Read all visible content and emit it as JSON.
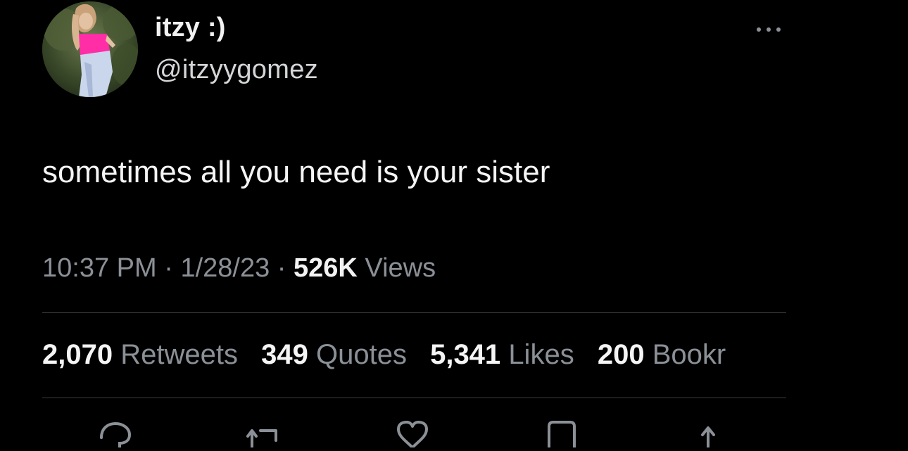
{
  "tweet": {
    "display_name": "itzy :)",
    "handle": "@itzyygomez",
    "text": "sometimes all you need is your sister",
    "time": "10:37 PM",
    "separator": "·",
    "date": "1/28/23",
    "views_count": "526K",
    "views_label": "Views"
  },
  "stats": [
    {
      "count": "2,070",
      "label": "Retweets"
    },
    {
      "count": "349",
      "label": "Quotes"
    },
    {
      "count": "5,341",
      "label": "Likes"
    },
    {
      "count": "200",
      "label": "Bookr"
    }
  ],
  "actions": [
    {
      "icon": "reply-icon"
    },
    {
      "icon": "retweet-icon"
    },
    {
      "icon": "like-icon"
    },
    {
      "icon": "bookmark-icon"
    },
    {
      "icon": "share-icon"
    }
  ],
  "colors": {
    "background": "#000000",
    "primary_text": "#f5f5f5",
    "secondary_text": "#8b9097",
    "divider": "#3a3d40"
  }
}
